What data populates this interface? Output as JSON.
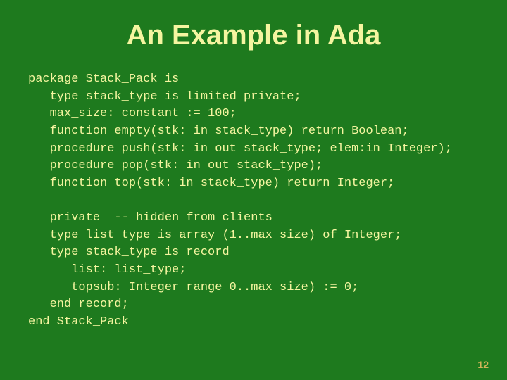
{
  "slide": {
    "title": "An Example in Ada",
    "code": "package Stack_Pack is\n   type stack_type is limited private;\n   max_size: constant := 100;\n   function empty(stk: in stack_type) return Boolean;\n   procedure push(stk: in out stack_type; elem:in Integer);\n   procedure pop(stk: in out stack_type);\n   function top(stk: in stack_type) return Integer;\n\n   private  -- hidden from clients\n   type list_type is array (1..max_size) of Integer;\n   type stack_type is record\n      list: list_type;\n      topsub: Integer range 0..max_size) := 0;\n   end record;\nend Stack_Pack",
    "page_number": "12"
  }
}
